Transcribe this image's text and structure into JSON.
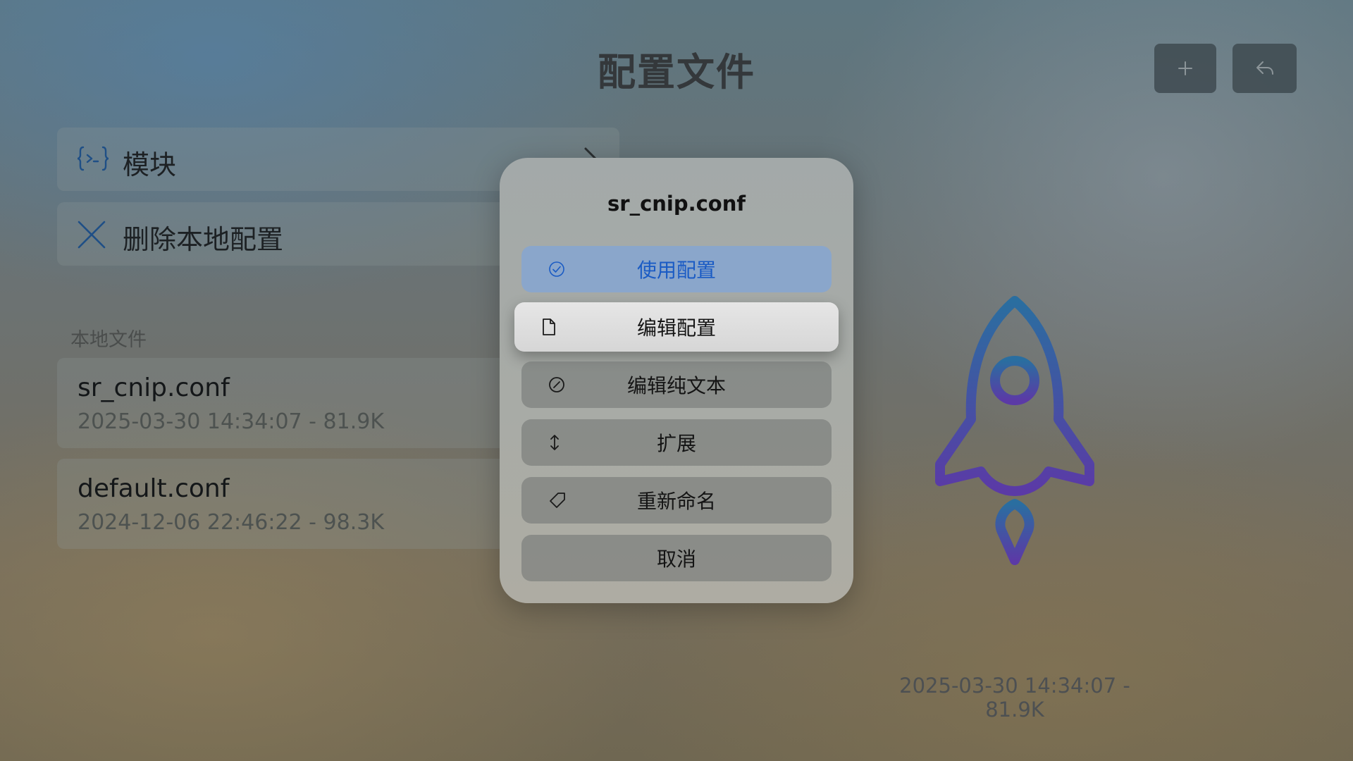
{
  "header": {
    "title": "配置文件",
    "add_icon": "plus-icon",
    "back_icon": "reply-icon"
  },
  "menu": {
    "modules_label": "模块",
    "modules_icon": "code-braces-icon",
    "delete_label": "删除本地配置",
    "delete_icon": "x-icon"
  },
  "local_files": {
    "header": "本地文件",
    "files": [
      {
        "name": "sr_cnip.conf",
        "meta": "2025-03-30 14:34:07 - 81.9K"
      },
      {
        "name": "default.conf",
        "meta": "2024-12-06 22:46:22 - 98.3K"
      }
    ]
  },
  "detail": {
    "logo_icon": "rocket-icon",
    "meta": "2025-03-30 14:34:07 - 81.9K"
  },
  "dialog": {
    "title": "sr_cnip.conf",
    "options": [
      {
        "label": "使用配置",
        "icon": "checkmark-circle-icon"
      },
      {
        "label": "编辑配置",
        "icon": "document-icon"
      },
      {
        "label": "编辑纯文本",
        "icon": "slash-circle-icon"
      },
      {
        "label": "扩展",
        "icon": "up-down-arrow-icon"
      },
      {
        "label": "重新命名",
        "icon": "tag-icon"
      },
      {
        "label": "取消"
      }
    ]
  },
  "colors": {
    "accent_text": "#1a5bc4",
    "accent_button": "#8aa6cb",
    "rocket_top": "#2a6ea0",
    "rocket_bottom": "#5b3aa6"
  }
}
